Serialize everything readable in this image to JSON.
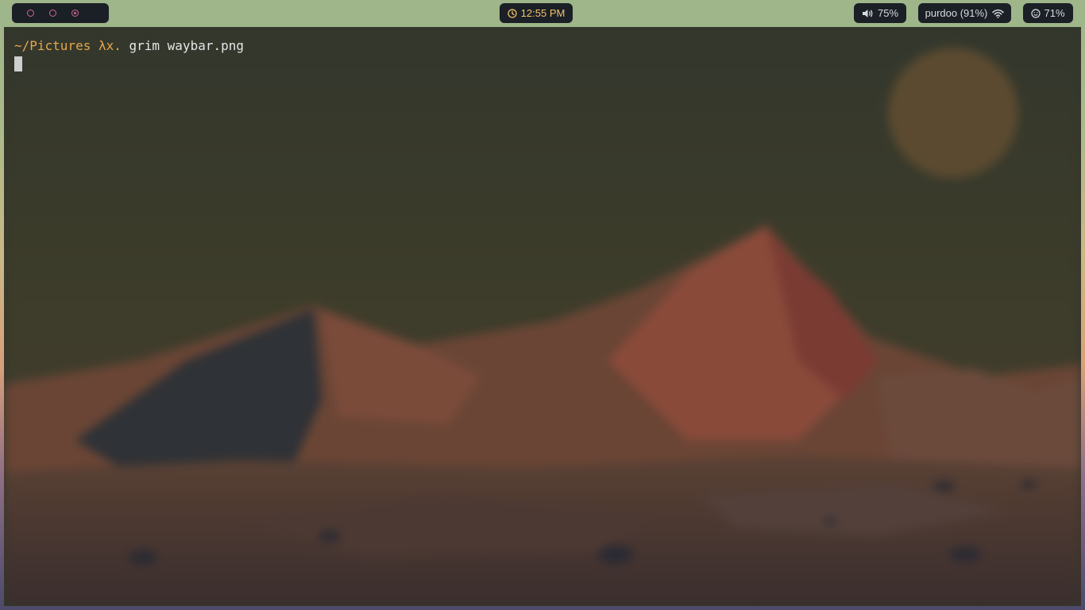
{
  "waybar": {
    "workspaces": [
      {
        "state": "empty"
      },
      {
        "state": "empty"
      },
      {
        "state": "active"
      }
    ],
    "clock": {
      "icon": "clock-icon",
      "time": "12:55 PM"
    },
    "volume": {
      "icon": "speaker-icon",
      "level": "75%"
    },
    "network": {
      "label": "purdoo (91%)",
      "icon": "wifi-icon"
    },
    "battery": {
      "icon": "smiley-icon",
      "level": "71%"
    },
    "colors": {
      "bar_bg": "#9fb58a",
      "pill_bg": "#1b1f26",
      "workspace_accent": "#d06a8f",
      "clock_text": "#f2c46a"
    }
  },
  "terminal": {
    "prompt": "~/Pictures λx.",
    "command": "grim waybar.png",
    "colors": {
      "prompt": "#e4a84a",
      "text": "#e6e6e6"
    }
  }
}
